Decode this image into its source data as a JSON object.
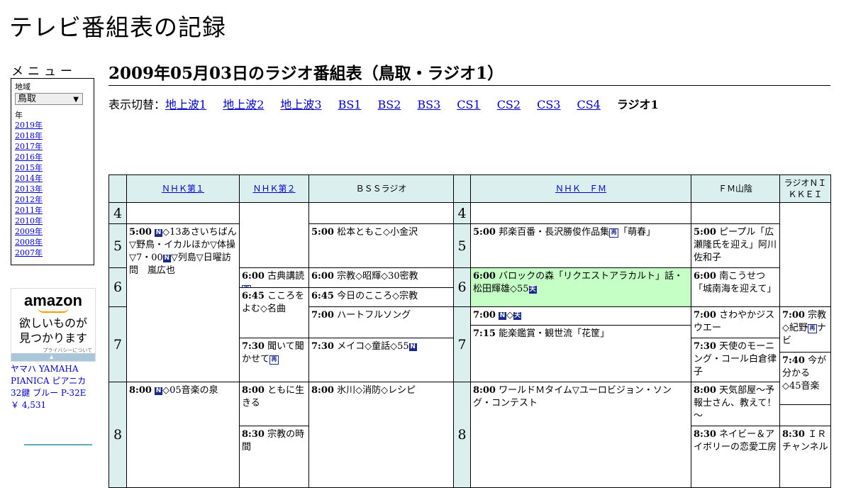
{
  "site_title": "テレビ番組表の記録",
  "sidebar": {
    "menu_label": "メニュー",
    "region_label": "地域",
    "region_value": "鳥取",
    "year_label": "年",
    "years": [
      "2019年",
      "2018年",
      "2017年",
      "2016年",
      "2015年",
      "2014年",
      "2013年",
      "2012年",
      "2011年",
      "2010年",
      "2009年",
      "2008年",
      "2007年"
    ]
  },
  "ad": {
    "logo": "amazon",
    "copy_line1": "欲しいものが",
    "copy_line2": "見つかります",
    "privacy": "プライバシーについて",
    "product_title": "ヤマハ YAMAHA PIANICA ピアニカ 32鍵 ブルー P-32E",
    "product_price": "￥ 4,531"
  },
  "main": {
    "heading": "2009年05月03日のラジオ番組表（鳥取・ラジオ1）",
    "switcher_label": "表示切替：",
    "switcher_links": [
      "地上波1",
      "地上波2",
      "地上波3",
      "BS1",
      "BS2",
      "BS3",
      "CS1",
      "CS2",
      "CS3",
      "CS4"
    ],
    "switcher_current": "ラジオ1"
  },
  "grid": {
    "hours": [
      "4",
      "5",
      "6",
      "7",
      "8"
    ],
    "channels": [
      "ＮＨＫ第１",
      "ＮＨＫ第２",
      "ＢＳＳラジオ",
      "ＮＨＫ　ＦＭ",
      "ＦＭ山陰",
      "ラジオＮＩＫＫＥＩ"
    ],
    "badge_n": "N",
    "badge_sai": "再",
    "badge_ten": "天",
    "programs": {
      "nhk1_500_time": "5:00",
      "nhk1_500_a": "◇13あさいちばん▽野鳥・イカルほか▽体操▽7・00",
      "nhk1_500_b": "▽列島▽日曜訪問　嵐広也",
      "nhk1_800_time": "8:00",
      "nhk1_800": "◇05音楽の泉",
      "nhk2_600_time": "6:00",
      "nhk2_600": "古典講読",
      "nhk2_645_time": "6:45",
      "nhk2_645": "こころをよむ◇名曲",
      "nhk2_730_time": "7:30",
      "nhk2_730": "聞いて聞かせて",
      "nhk2_800_time": "8:00",
      "nhk2_800": "ともに生きる",
      "nhk2_830_time": "8:30",
      "nhk2_830": "宗教の時間",
      "bss_500_time": "5:00",
      "bss_500": "松本ともこ◇小金沢",
      "bss_600_time": "6:00",
      "bss_600": "宗教◇昭輝◇30密教",
      "bss_645_time": "6:45",
      "bss_645": "今日のこころ◇宗教",
      "bss_700_time": "7:00",
      "bss_700": "ハートフルソング",
      "bss_730_time": "7:30",
      "bss_730": "メイコ◇童話◇55",
      "bss_800_time": "8:00",
      "bss_800": "氷川◇消防◇レシピ",
      "fm_500_time": "5:00",
      "fm_500": "邦楽百番・長沢勝俊作品集",
      "fm_500_b": "「萌春」",
      "fm_600_time": "6:00",
      "fm_600": "バロックの森「リクエストアラカルト」話・松田輝雄◇55",
      "fm_700_time": "7:00",
      "fm_700": "◇",
      "fm_715_time": "7:15",
      "fm_715": "能楽鑑賞・観世流「花筐」",
      "fm_800_time": "8:00",
      "fm_800": "ワールドＭタイム▽ユーロビジョン・ソング・コンテスト",
      "fms_500_time": "5:00",
      "fms_500": "ピープル「広瀬隆氏を迎え」阿川佐和子",
      "fms_600_time": "6:00",
      "fms_600": "南こうせつ「城南海を迎えて」",
      "fms_700_time": "7:00",
      "fms_700": "さわやかジスウエー",
      "fms_730_time": "7:30",
      "fms_730": "天使のモーニング・コール白倉律子",
      "fms_800_time": "8:00",
      "fms_800": "天気部屋～予報士さん、教えて！～",
      "fms_830_time": "8:30",
      "fms_830": "ネイビー＆アイボリーの恋愛工房",
      "nk_700_time": "7:00",
      "nk_700": "宗教◇紀野",
      "nk_700_b": "ナビ",
      "nk_740_time": "7:40",
      "nk_740": "今が分かる◇45音楽",
      "nk_830_time": "8:30",
      "nk_830": "ＩＲチャンネル"
    }
  }
}
